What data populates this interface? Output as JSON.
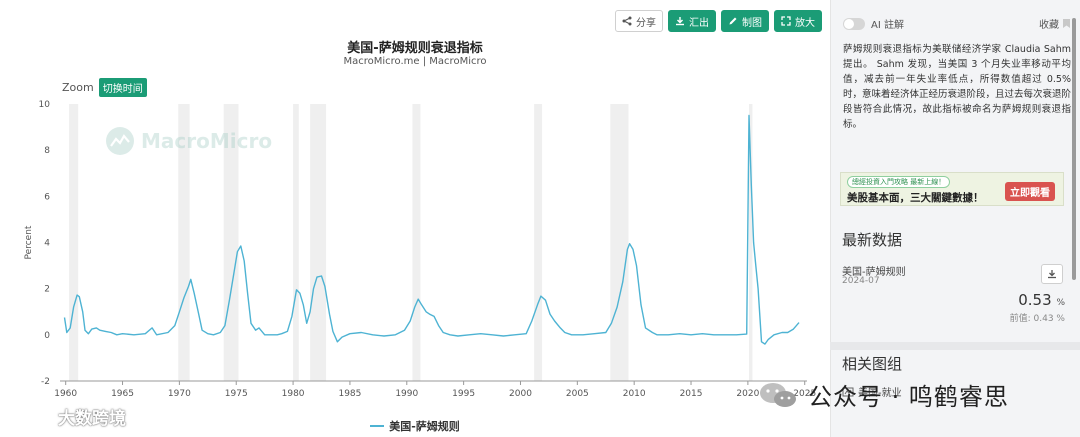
{
  "toolbar": {
    "share_label": "分享",
    "export_label": "汇出",
    "draw_label": "制图",
    "zoom_label": "放大",
    "accent_color": "#1b9c76"
  },
  "chart_header": {
    "title": "美国-萨姆规则衰退指标",
    "subtitle": "MacroMicro.me | MacroMicro"
  },
  "zoom_control": {
    "label": "Zoom",
    "button_label": "切换时间"
  },
  "watermark_text": "MacroMicro",
  "corner_brand_text": "大数跨境",
  "bottom_watermark_text": "公众号 · 鸣鹤睿思",
  "chart_data": {
    "type": "line",
    "title": "美国-萨姆规则衰退指标",
    "subtitle": "MacroMicro.me | MacroMicro",
    "ylabel": "Percent",
    "xlabel": "",
    "xlim": [
      1959.5,
      2025.2
    ],
    "ylim": [
      -2,
      10
    ],
    "yticks": [
      -2,
      0,
      2,
      4,
      6,
      8,
      10
    ],
    "xticks": [
      1960,
      1965,
      1970,
      1975,
      1980,
      1985,
      1990,
      1995,
      2000,
      2005,
      2010,
      2015,
      2020,
      2025
    ],
    "grid": false,
    "legend_position": "bottom-center",
    "series": [
      {
        "name": "美国-萨姆规则",
        "color": "#4eb3d3",
        "x": [
          1959.9,
          1960.1,
          1960.4,
          1960.7,
          1961.0,
          1961.2,
          1961.5,
          1961.7,
          1962.0,
          1962.3,
          1962.7,
          1963.0,
          1963.5,
          1964.0,
          1964.5,
          1965.0,
          1966.0,
          1967.0,
          1967.6,
          1968.0,
          1969.0,
          1969.6,
          1970.0,
          1970.4,
          1970.8,
          1971.0,
          1971.3,
          1971.7,
          1972.0,
          1972.5,
          1973.0,
          1973.6,
          1974.0,
          1974.4,
          1974.8,
          1975.1,
          1975.4,
          1975.7,
          1976.0,
          1976.3,
          1976.7,
          1977.0,
          1977.5,
          1978.0,
          1978.6,
          1979.0,
          1979.5,
          1979.9,
          1980.3,
          1980.6,
          1980.9,
          1981.2,
          1981.5,
          1981.8,
          1982.1,
          1982.5,
          1982.8,
          1983.2,
          1983.5,
          1983.9,
          1984.3,
          1985.0,
          1986.0,
          1987.0,
          1988.0,
          1989.0,
          1989.8,
          1990.3,
          1990.7,
          1991.0,
          1991.3,
          1991.7,
          1992.0,
          1992.4,
          1992.8,
          1993.2,
          1993.8,
          1994.5,
          1995.5,
          1996.5,
          1997.5,
          1998.5,
          1999.5,
          2000.5,
          2001.0,
          2001.5,
          2001.8,
          2002.2,
          2002.6,
          2003.0,
          2003.5,
          2003.9,
          2004.5,
          2005.5,
          2006.5,
          2007.5,
          2008.0,
          2008.5,
          2009.0,
          2009.4,
          2009.6,
          2009.9,
          2010.2,
          2010.6,
          2011.0,
          2011.6,
          2012.0,
          2013.0,
          2014.0,
          2015.0,
          2016.0,
          2017.0,
          2018.0,
          2019.0,
          2019.9,
          2020.1,
          2020.3,
          2020.5,
          2020.7,
          2020.9,
          2021.2,
          2021.5,
          2021.8,
          2022.3,
          2023.0,
          2023.5,
          2024.0,
          2024.5
        ],
        "values": [
          0.75,
          0.1,
          0.3,
          1.2,
          1.72,
          1.65,
          1.0,
          0.2,
          0.05,
          0.25,
          0.3,
          0.2,
          0.15,
          0.1,
          0.0,
          0.05,
          0.0,
          0.05,
          0.3,
          0.0,
          0.1,
          0.4,
          1.0,
          1.6,
          2.1,
          2.4,
          1.8,
          0.9,
          0.2,
          0.05,
          0.0,
          0.1,
          0.4,
          1.5,
          2.7,
          3.6,
          3.85,
          3.2,
          1.8,
          0.5,
          0.2,
          0.3,
          0.0,
          0.0,
          0.0,
          0.05,
          0.15,
          0.8,
          1.95,
          1.8,
          1.3,
          0.5,
          1.0,
          2.0,
          2.5,
          2.55,
          2.1,
          0.9,
          0.15,
          -0.3,
          -0.1,
          0.05,
          0.1,
          0.0,
          -0.05,
          0.0,
          0.2,
          0.6,
          1.2,
          1.55,
          1.3,
          1.0,
          0.9,
          0.8,
          0.4,
          0.1,
          0.0,
          -0.05,
          0.0,
          0.05,
          0.0,
          -0.05,
          0.0,
          0.05,
          0.6,
          1.3,
          1.68,
          1.5,
          0.9,
          0.6,
          0.3,
          0.1,
          0.0,
          0.0,
          0.05,
          0.1,
          0.5,
          1.2,
          2.3,
          3.7,
          3.95,
          3.7,
          3.0,
          1.3,
          0.3,
          0.1,
          0.0,
          0.0,
          0.05,
          0.0,
          0.05,
          0.0,
          0.0,
          0.0,
          0.03,
          9.5,
          6.5,
          4.0,
          3.0,
          2.0,
          -0.3,
          -0.4,
          -0.2,
          0.0,
          0.1,
          0.1,
          0.25,
          0.53
        ]
      }
    ],
    "recessions": [
      [
        1960.3,
        1961.1
      ],
      [
        1969.9,
        1970.9
      ],
      [
        1973.9,
        1975.2
      ],
      [
        1980.0,
        1980.5
      ],
      [
        1981.5,
        1982.9
      ],
      [
        1990.5,
        1991.2
      ],
      [
        2001.2,
        2001.9
      ],
      [
        2007.9,
        2009.5
      ],
      [
        2020.1,
        2020.4
      ]
    ]
  },
  "panel": {
    "ai_label": "AI 註解",
    "favorite_label": "收藏",
    "description": "萨姆规则衰退指标为美联储经济学家 Claudia Sahm 提出。 Sahm 发现，当美国 3 个月失业率移动平均值，减去前一年失业率低点，所得数值超过 0.5% 时，意味着经济体正经历衰退阶段，且过去每次衰退阶段皆符合此情况，故此指标被命名为萨姆规则衰退指标。",
    "banner": {
      "top_text": "總經投資入門攻略 最新上線！",
      "main_text": "美股基本面，三大關鍵數據！",
      "cta": "立即觀看"
    },
    "latest_title": "最新数据",
    "latest_item": {
      "name": "美国-萨姆规则",
      "date": "2024-07",
      "value": "0.53",
      "unit": "%",
      "previous": "前值: 0.43 %"
    },
    "related_title": "相关图组",
    "related_item": "美国-就业"
  }
}
